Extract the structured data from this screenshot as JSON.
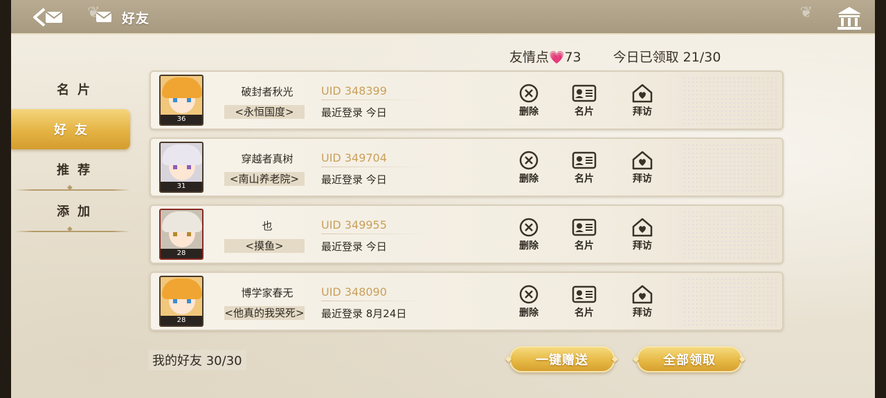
{
  "header": {
    "title": "好友"
  },
  "status": {
    "friendship_label": "友情点",
    "friendship_value": "73",
    "claimed_label": "今日已领取 21/30"
  },
  "sidebar": {
    "items": [
      {
        "label": "名片",
        "active": false
      },
      {
        "label": "好友",
        "active": true
      },
      {
        "label": "推荐",
        "active": false
      },
      {
        "label": "添加",
        "active": false
      }
    ]
  },
  "friends": [
    {
      "name": "破封者秋光",
      "guild": "<永恒国度>",
      "uid": "UID 348399",
      "login": "最近登录 今日",
      "level": "36",
      "avatar_style": "blonde"
    },
    {
      "name": "穿越者真树",
      "guild": "<南山养老院>",
      "uid": "UID 349704",
      "login": "最近登录 今日",
      "level": "31",
      "avatar_style": "silver"
    },
    {
      "name": "也",
      "guild": "<摸鱼>",
      "uid": "UID 349955",
      "login": "最近登录 今日",
      "level": "28",
      "avatar_style": "gray"
    },
    {
      "name": "博学家春无",
      "guild": "<他真的我哭死>",
      "uid": "UID 348090",
      "login": "最近登录 8月24日",
      "level": "28",
      "avatar_style": "blonde"
    }
  ],
  "actions": {
    "delete": "删除",
    "card": "名片",
    "visit": "拜访"
  },
  "footer": {
    "friend_count": "我的好友 30/30",
    "send_all": "一键赠送",
    "claim_all": "全部领取"
  },
  "colors": {
    "accent_gold": "#e4b343",
    "uid_gold": "#c9a05a",
    "heart_pink": "#e0509a"
  }
}
